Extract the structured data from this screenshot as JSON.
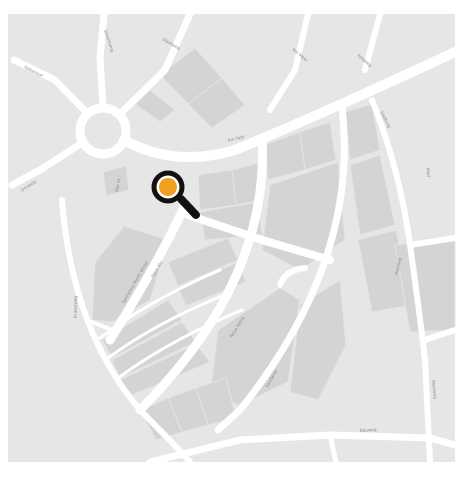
{
  "map": {
    "background_color": "#e6e6e6",
    "road_color": "#ffffff",
    "block_color": "#d4d4d4",
    "label_color": "#8a8a8a",
    "street_labels": [
      "Falkenhof",
      "Sprenkamp",
      "Stadtweg",
      "Am Meer",
      "Feldweg",
      "Siedlung",
      "Ortsweg",
      "Am Feld",
      "Finkenweg",
      "Haus Str.",
      "Neue Reihe",
      "Sandweg",
      "Postweg",
      "Pfad",
      "Westweg",
      "Bauweg"
    ],
    "building_labels": [
      "Mar kt",
      "Sportplatz Markt Wiese"
    ]
  },
  "marker": {
    "icon": "search-magnifier-icon",
    "ring_color": "#111111",
    "fill_color": "#f0a020"
  }
}
